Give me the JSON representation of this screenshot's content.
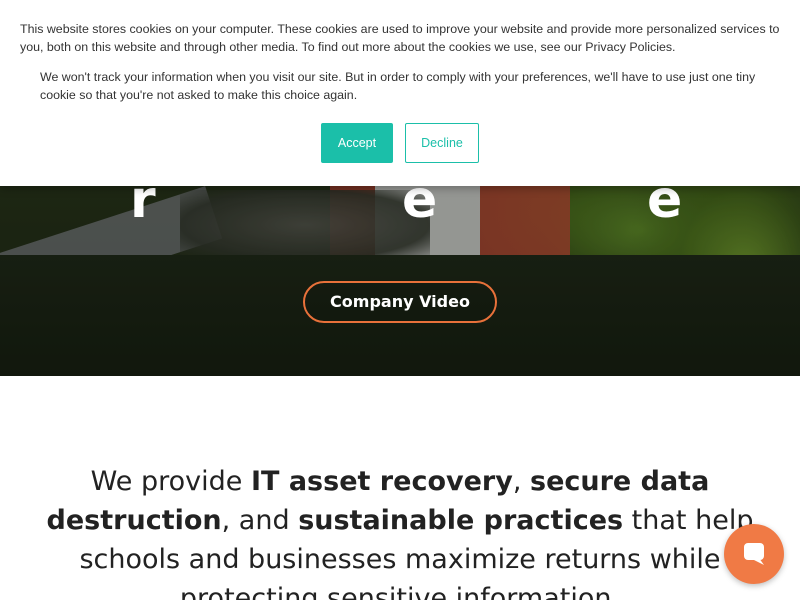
{
  "cookie_banner": {
    "text_primary": "This website stores cookies on your computer. These cookies are used to improve your website and provide more personalized services to you, both on this website and through other media. To find out more about the cookies we use, see our Privacy Policies.",
    "text_secondary": "We won't track your information when you visit our site. But in order to comply with your preferences, we'll have to use just one tiny cookie so that you're not asked to make this choice again.",
    "accept_label": "Accept",
    "decline_label": "Decline",
    "accent_color": "#1bbfa9"
  },
  "hero": {
    "letters": [
      "r",
      "e",
      "e"
    ],
    "video_button_label": "Company Video",
    "button_border_color": "#e8713a"
  },
  "intro": {
    "part1": "We provide ",
    "bold1": "IT asset recovery",
    "part2": ", ",
    "bold2": "secure data destruction",
    "part3": ", and ",
    "bold3": "sustainable practices",
    "part4": " that help schools and businesses maximize returns while protecting sensitive information."
  },
  "chat_widget": {
    "icon": "chat-bubble-icon",
    "color": "#f07a45"
  }
}
